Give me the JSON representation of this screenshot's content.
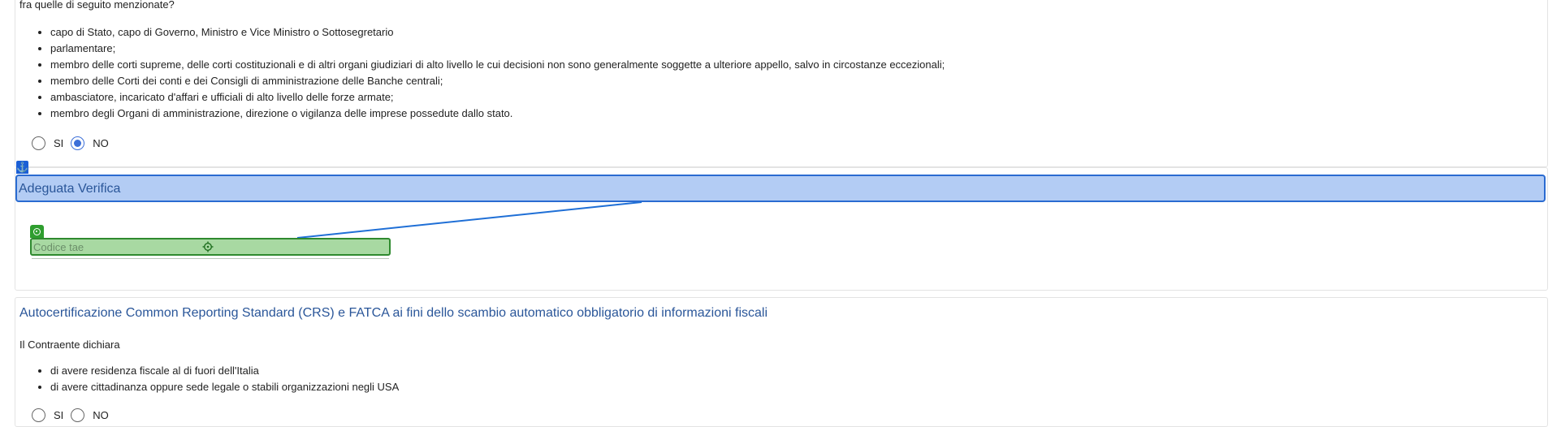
{
  "pep_section": {
    "intro": "fra quelle di seguito menzionate?",
    "items": [
      "capo di Stato, capo di Governo, Ministro e Vice Ministro o Sottosegretario",
      "parlamentare;",
      "membro delle corti supreme, delle corti costituzionali e di altri organi giudiziari di alto livello le cui decisioni non sono generalmente soggette a ulteriore appello, salvo in circostanze eccezionali;",
      "membro delle Corti dei conti e dei Consigli di amministrazione delle Banche centrali;",
      "ambasciatore, incaricato d'affari e ufficiali di alto livello delle forze armate;",
      "membro degli Organi di amministrazione, direzione o vigilanza delle imprese possedute dallo stato."
    ],
    "radio": {
      "yes_label": "SI",
      "no_label": "NO",
      "selected": "NO"
    }
  },
  "anchor_icon": "anchor-icon",
  "adeguata": {
    "title": "Adeguata Verifica",
    "field": {
      "placeholder": "Codice tae",
      "value": "",
      "tag_icon": "target-ring-icon",
      "locator_icon": "crosshair-icon"
    }
  },
  "crs": {
    "title": "Autocertificazione Common Reporting Standard (CRS) e FATCA ai fini dello scambio automatico obbligatorio di informazioni fiscali",
    "declaration": "Il Contraente dichiara",
    "items": [
      "di avere residenza fiscale al di fuori dell'Italia",
      "di avere cittadinanza oppure sede legale o stabili organizzazioni negli USA"
    ],
    "radio": {
      "yes_label": "SI",
      "no_label": "NO",
      "selected": ""
    }
  },
  "colors": {
    "section_title": "#2a5699",
    "banner_fill": "#b3ccf4",
    "banner_border": "#2a6bd1",
    "field_fill": "#a8d9a2",
    "field_border": "#2f8a2f",
    "radio_checked": "#3c6fd8"
  }
}
